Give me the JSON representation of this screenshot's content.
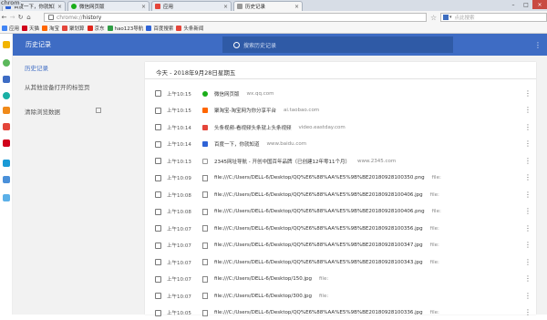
{
  "corner_label": "chrom",
  "tabs": [
    {
      "title": "百度一下，你就知道",
      "icon_color": "#2f63d6",
      "active": false
    },
    {
      "title": "微信网页版",
      "icon_color": "#1aad19",
      "active": false
    },
    {
      "title": "应用",
      "icon_color": "#e4453a",
      "active": false
    },
    {
      "title": "历史记录",
      "icon_color": "#888888",
      "active": true
    }
  ],
  "toolbar": {
    "url_scheme": "chrome://",
    "url_path": "history",
    "search_placeholder": "点此搜索"
  },
  "bookmarks": [
    {
      "label": "应用",
      "color": "#4285f4"
    },
    {
      "label": "天猫",
      "color": "#d0021b"
    },
    {
      "label": "淘宝",
      "color": "#ff6600"
    },
    {
      "label": "聚划算",
      "color": "#e4453a"
    },
    {
      "label": "京东",
      "color": "#e1251b"
    },
    {
      "label": "hao123导航",
      "color": "#2f9e44"
    },
    {
      "label": "百度搜索",
      "color": "#2f63d6"
    },
    {
      "label": "头条新闻",
      "color": "#e4453a"
    }
  ],
  "header": {
    "title": "历史记录",
    "search_placeholder": "搜索历史记录"
  },
  "left_nav": {
    "history": "历史记录",
    "other_devices": "从其他设备打开的标签页",
    "clear": "清除浏览数据"
  },
  "card": {
    "date_title": "今天 - 2018年9月28日星期五"
  },
  "rows": [
    {
      "time": "上午10:15",
      "title": "微信网页版",
      "domain": "wx.qq.com",
      "icon": "wechat-icon",
      "color": "#1aad19"
    },
    {
      "time": "上午10:15",
      "title": "聚淘宝-淘宝网为你分享平台",
      "domain": "ai.taobao.com",
      "icon": "taobao-icon",
      "color": "#ff6600"
    },
    {
      "time": "上午10:14",
      "title": "头条视频-看视频头条就上头条视频",
      "domain": "video.eastday.com",
      "icon": "video-icon",
      "color": "#e4453a"
    },
    {
      "time": "上午10:14",
      "title": "百度一下，你就知道",
      "domain": "www.baidu.com",
      "icon": "baidu-icon",
      "color": "#2f63d6"
    },
    {
      "time": "上午10:13",
      "title": "2345网址导航 - 开创中国百年品牌（已创建12年零11个月）",
      "domain": "www.2345.com",
      "icon": "page-icon",
      "color": "#ffffff"
    },
    {
      "time": "上午10:09",
      "title": "file:///C:/Users/DELL-6/Desktop/QQ%E6%88%AA%E5%9B%BE20180928100350.png",
      "domain": "file:",
      "icon": "file-icon",
      "color": "#ffffff"
    },
    {
      "time": "上午10:08",
      "title": "file:///C:/Users/DELL-6/Desktop/QQ%E6%88%AA%E5%9B%BE20180928100406.jpg",
      "domain": "file:",
      "icon": "file-icon",
      "color": "#ffffff"
    },
    {
      "time": "上午10:08",
      "title": "file:///C:/Users/DELL-6/Desktop/QQ%E6%88%AA%E5%9B%BE20180928100406.png",
      "domain": "file:",
      "icon": "file-icon",
      "color": "#ffffff"
    },
    {
      "time": "上午10:07",
      "title": "file:///C:/Users/DELL-6/Desktop/QQ%E6%88%AA%E5%9B%BE20180928100356.jpg",
      "domain": "file:",
      "icon": "file-icon",
      "color": "#ffffff"
    },
    {
      "time": "上午10:07",
      "title": "file:///C:/Users/DELL-6/Desktop/QQ%E6%88%AA%E5%9B%BE20180928100347.jpg",
      "domain": "file:",
      "icon": "file-icon",
      "color": "#ffffff"
    },
    {
      "time": "上午10:07",
      "title": "file:///C:/Users/DELL-6/Desktop/QQ%E6%88%AA%E5%9B%BE20180928100343.jpg",
      "domain": "file:",
      "icon": "file-icon",
      "color": "#ffffff"
    },
    {
      "time": "上午10:07",
      "title": "file:///C:/Users/DELL-6/Desktop/150.jpg",
      "domain": "file:",
      "icon": "file-icon",
      "color": "#ffffff"
    },
    {
      "time": "上午10:07",
      "title": "file:///C:/Users/DELL-6/Desktop/300.jpg",
      "domain": "file:",
      "icon": "file-icon",
      "color": "#ffffff"
    },
    {
      "time": "上午10:05",
      "title": "file:///C:/Users/DELL-6/Desktop/QQ%E6%88%AA%E5%9B%BE20180928100336.jpg",
      "domain": "file:",
      "icon": "file-icon",
      "color": "#ffffff"
    }
  ]
}
